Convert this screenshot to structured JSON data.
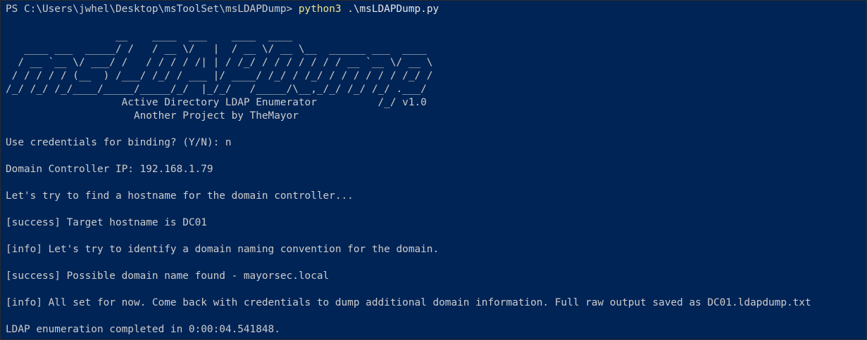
{
  "terminal": {
    "prompt": "PS C:\\Users\\jwhel\\Desktop\\msToolSet\\msLDAPDump> ",
    "command": "python3",
    "command_args": " .\\msLDAPDump.py",
    "banner": [
      "                  __    ____  ___    ____  ____",
      "   ____ ___  _____/ /   / __ \\/   |  / __ \\/ __ \\__  ______ ___  ____",
      "  / __ `__ \\/ ___/ /   / / / / /| | / /_/ / / / / / / / __ `__ \\/ __ \\",
      " / / / / / (__  ) /___/ /_/ / ___ |/ ____/ /_/ / /_/ / / / / / / /_/ /",
      "/_/ /_/ /_/____/_____/_____/_/  |_/_/   /_____/\\__,_/_/ /_/ /_/ .___/",
      "                   Active Directory LDAP Enumerator          /_/ v1.0",
      "                     Another Project by TheMayor"
    ],
    "credentials_prompt": "Use credentials for binding? (Y/N): n",
    "dc_ip": "Domain Controller IP: 192.168.1.79",
    "find_hostname": "Let's try to find a hostname for the domain controller...",
    "success_hostname": "[success] Target hostname is DC01",
    "info_naming": "[info] Let's try to identify a domain naming convention for the domain.",
    "success_domain": "[success] Possible domain name found - mayorsec.local",
    "info_done": "[info] All set for now. Come back with credentials to dump additional domain information. Full raw output saved as DC01.ldapdump.txt",
    "completed": "LDAP enumeration completed in 0:00:04.541848."
  },
  "colors": {
    "background": "#012456",
    "default_text": "#cccccc",
    "banner": "#f0e68c",
    "success": "#16c60c",
    "bright_text": "#e6e6e6"
  }
}
